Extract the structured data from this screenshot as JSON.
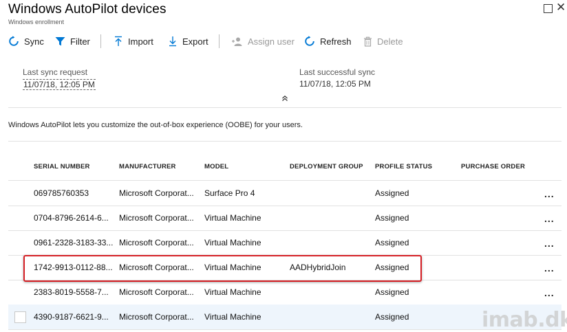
{
  "window": {
    "title": "Windows AutoPilot devices",
    "subtitle": "Windows enrollment"
  },
  "toolbar": {
    "sync": "Sync",
    "filter": "Filter",
    "import": "Import",
    "export": "Export",
    "assign_user": "Assign user",
    "refresh": "Refresh",
    "delete": "Delete"
  },
  "sync_info": {
    "last_request_label": "Last sync request",
    "last_request_value": "11/07/18, 12:05 PM",
    "last_success_label": "Last successful sync",
    "last_success_value": "11/07/18, 12:05 PM",
    "collapse_glyph": "⌃"
  },
  "description": "Windows AutoPilot lets you customize the out-of-box experience (OOBE) for your users.",
  "table": {
    "columns": [
      "SERIAL NUMBER",
      "MANUFACTURER",
      "MODEL",
      "DEPLOYMENT GROUP",
      "PROFILE STATUS",
      "PURCHASE ORDER"
    ],
    "rows": [
      {
        "serial": "069785760353",
        "manufacturer": "Microsoft Corporat...",
        "model": "Surface Pro 4",
        "group": "",
        "status": "Assigned",
        "order": ""
      },
      {
        "serial": "0704-8796-2614-6...",
        "manufacturer": "Microsoft Corporat...",
        "model": "Virtual Machine",
        "group": "",
        "status": "Assigned",
        "order": ""
      },
      {
        "serial": "0961-2328-3183-33...",
        "manufacturer": "Microsoft Corporat...",
        "model": "Virtual Machine",
        "group": "",
        "status": "Assigned",
        "order": ""
      },
      {
        "serial": "1742-9913-0112-88...",
        "manufacturer": "Microsoft Corporat...",
        "model": "Virtual Machine",
        "group": "AADHybridJoin",
        "status": "Assigned",
        "order": ""
      },
      {
        "serial": "2383-8019-5558-7...",
        "manufacturer": "Microsoft Corporat...",
        "model": "Virtual Machine",
        "group": "",
        "status": "Assigned",
        "order": ""
      },
      {
        "serial": "4390-9187-6621-9...",
        "manufacturer": "Microsoft Corporat...",
        "model": "Virtual Machine",
        "group": "",
        "status": "Assigned",
        "order": ""
      }
    ],
    "more_glyph": "...",
    "selected_row_index": 5,
    "highlighted_row_index": 3
  },
  "watermark": "imab.dk",
  "colors": {
    "accent": "#0078d4",
    "highlight_border": "#d51e24",
    "selected_row": "#eef5fc",
    "disabled": "#9a9a9a"
  }
}
